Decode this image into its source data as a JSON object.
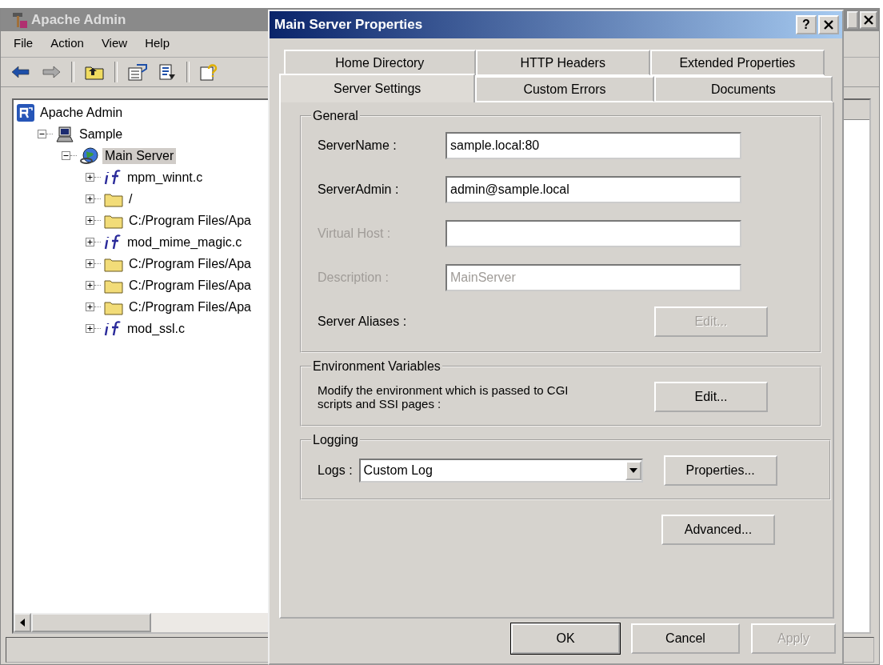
{
  "main_window": {
    "title": "Apache Admin",
    "menu": [
      "File",
      "Action",
      "View",
      "Help"
    ],
    "toolbar": [
      {
        "kind": "back",
        "disabled": false
      },
      {
        "kind": "forward",
        "disabled": true
      },
      {
        "kind": "up-folder",
        "disabled": false
      },
      {
        "kind": "properties",
        "disabled": false
      },
      {
        "kind": "export",
        "disabled": false
      },
      {
        "kind": "help",
        "disabled": false
      }
    ],
    "tree": [
      {
        "label": "Apache Admin",
        "kind": "app",
        "selected": false,
        "children": [
          {
            "label": "Sample",
            "kind": "computer",
            "expanded": true,
            "selected": false,
            "children": [
              {
                "label": "Main Server",
                "kind": "server",
                "expanded": true,
                "selected": true,
                "children": [
                  {
                    "label": "mpm_winnt.c",
                    "kind": "module",
                    "expanded": false,
                    "selected": false
                  },
                  {
                    "label": "/",
                    "kind": "folder",
                    "expanded": false,
                    "selected": false
                  },
                  {
                    "label": "C:/Program Files/Apa",
                    "kind": "folder",
                    "expanded": false,
                    "selected": false
                  },
                  {
                    "label": "mod_mime_magic.c",
                    "kind": "module",
                    "expanded": false,
                    "selected": false
                  },
                  {
                    "label": "C:/Program Files/Apa",
                    "kind": "folder",
                    "expanded": false,
                    "selected": false
                  },
                  {
                    "label": "C:/Program Files/Apa",
                    "kind": "folder",
                    "expanded": false,
                    "selected": false
                  },
                  {
                    "label": "C:/Program Files/Apa",
                    "kind": "folder",
                    "expanded": false,
                    "selected": false
                  },
                  {
                    "label": "mod_ssl.c",
                    "kind": "module",
                    "expanded": false,
                    "selected": false
                  }
                ]
              }
            ]
          }
        ]
      }
    ]
  },
  "dialog": {
    "title": "Main Server Properties",
    "help_button": "?",
    "tab_rows": [
      [
        {
          "label": "Home Directory",
          "selected": false
        },
        {
          "label": "HTTP Headers",
          "selected": false
        },
        {
          "label": "Extended Properties",
          "selected": false
        }
      ],
      [
        {
          "label": "Server Settings",
          "selected": true
        },
        {
          "label": "Custom Errors",
          "selected": false
        },
        {
          "label": "Documents",
          "selected": false
        }
      ]
    ],
    "general": {
      "title": "General",
      "rows": [
        {
          "kind": "field",
          "label": "ServerName :",
          "value": "sample.local:80",
          "disabled": false
        },
        {
          "kind": "field",
          "label": "ServerAdmin :",
          "value": "admin@sample.local",
          "disabled": false
        },
        {
          "kind": "field",
          "label": "Virtual Host :",
          "disabled": true
        },
        {
          "kind": "field",
          "label": "Description :",
          "value": "MainServer",
          "disabled": true
        },
        {
          "kind": "button",
          "label": "Server Aliases :",
          "button": "Edit...",
          "disabled": true
        }
      ]
    },
    "environment": {
      "title": "Environment Variables",
      "text": "Modify the environment which is passed to CGI scripts and SSI pages  :",
      "button": "Edit..."
    },
    "logging": {
      "title": "Logging",
      "label": "Logs :",
      "value": "Custom Log",
      "button": "Properties..."
    },
    "advanced_button": "Advanced...",
    "buttons": [
      {
        "label": "OK",
        "default": true,
        "disabled": false
      },
      {
        "label": "Cancel",
        "default": false,
        "disabled": false
      },
      {
        "label": "Apply",
        "default": false,
        "disabled": true
      }
    ]
  }
}
